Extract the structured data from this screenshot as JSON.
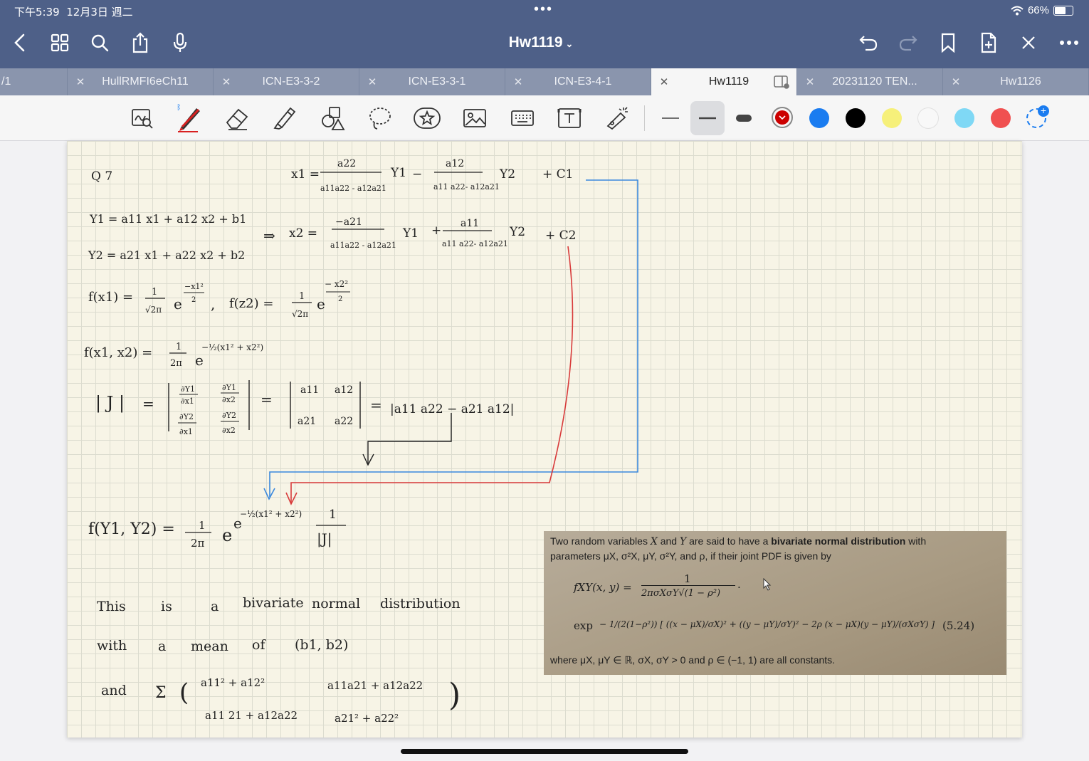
{
  "status_bar": {
    "time": "下午5:39",
    "date": "12月3日 週二",
    "dots": "•••",
    "battery": "66%"
  },
  "nav": {
    "title": "Hw1119"
  },
  "tabs": [
    {
      "label": "/1",
      "active": false
    },
    {
      "label": "HullRMFI6eCh11",
      "active": false
    },
    {
      "label": "ICN-E3-3-2",
      "active": false
    },
    {
      "label": "ICN-E3-3-1",
      "active": false
    },
    {
      "label": "ICN-E3-4-1",
      "active": false
    },
    {
      "label": "Hw1119",
      "active": true
    },
    {
      "label": "20231120 TEN...",
      "active": false
    },
    {
      "label": "Hw1126",
      "active": false
    }
  ],
  "toolbar": {
    "tools": [
      "zoom-window-icon",
      "pen-icon",
      "eraser-icon",
      "highlighter-icon",
      "shapes-icon",
      "lasso-icon",
      "sticker-icon",
      "image-icon",
      "keyboard-icon",
      "text-box-icon",
      "laser-pointer-icon"
    ],
    "stroke_widths": [
      "thin",
      "medium",
      "thick"
    ],
    "colors": [
      "#cc0000",
      "#1a7cf0",
      "#000000",
      "#f6f07a",
      "#f8f8f8",
      "#7fd8f5",
      "#f05050"
    ]
  },
  "notes": {
    "q": "Q 7",
    "x1_lhs": "x1 =",
    "x1_t1_num": "a22",
    "x1_t1_den": "a11a22 - a12a21",
    "x1_t1_var": "Y1",
    "minus": "−",
    "x1_t2_num": "a12",
    "x1_t2_den": "a11 a22- a12a21",
    "x1_t2_var": "Y2",
    "x1_c": "+ C1",
    "y1_eq": "Y1 = a11 x1 + a12 x2 + b1",
    "y2_eq": "Y2 = a21 x1 + a22 x2 + b2",
    "implies": "⇒",
    "x2_lhs": "x2 =",
    "x2_t1_num": "−a21",
    "x2_t1_den": "a11a22 - a12a21",
    "x2_t1_var": "Y1",
    "plus": "+",
    "x2_t2_num": "a11",
    "x2_t2_den": "a11 a22- a12a21",
    "x2_t2_var": "Y2",
    "x2_c": "+ C2",
    "fx1_lhs": "f(x1) =",
    "one": "1",
    "sqrt2pi": "√2π",
    "e": "e",
    "exp_x1": "−x1²",
    "two": "2",
    "comma": ",",
    "fz2_lhs": "f(z2) =",
    "exp_x2": "− x2²",
    "fx1x2_lhs": "f(x1, x2) =",
    "two_pi": "2π",
    "exp_joint": "−½(x1² + x2²)",
    "J_abs": "| J |",
    "eq": "=",
    "d_y1_x1_n": "∂Y1",
    "d_y1_x1_d": "∂x1",
    "d_y1_x2_n": "∂Y1",
    "d_y1_x2_d": "∂x2",
    "d_y2_x1_n": "∂Y2",
    "d_y2_x1_d": "∂x1",
    "d_y2_x2_n": "∂Y2",
    "d_y2_x2_d": "∂x2",
    "m_a11": "a11",
    "m_a12": "a12",
    "m_a21": "a21",
    "m_a22": "a22",
    "det_value": "|a11 a22 − a21 a12|",
    "fy_lhs": "f(Y1, Y2) =",
    "exp_final": "−½(x1² + x2²)",
    "abs_J": "|J|",
    "line1": [
      "This",
      "is",
      "a",
      "bivariate",
      "normal",
      "distribution"
    ],
    "line2": [
      "with",
      "a",
      "mean",
      "of",
      "(b1, b2)"
    ],
    "and": "and",
    "sigma": "Σ",
    "cov_11": "a11² + a12²",
    "cov_12": "a11a21 + a12a22",
    "cov_21": "a11 21 + a12a22",
    "cov_22": "a21² + a22²"
  },
  "textbook": {
    "intro_a": "Two random variables",
    "X": "X",
    "and_word": "and",
    "Y": "Y",
    "intro_b": "are said to have a",
    "bold": "bivariate normal distribution",
    "intro_c": "with",
    "params": "parameters μX, σ²X, μY, σ²Y, and ρ, if their joint PDF is given by",
    "f_lhs": "fXY(x, y) =",
    "f_num": "1",
    "f_den": "2πσXσY√(1 − ρ²)",
    "f_dot": "·",
    "exp_word": "exp",
    "exp_body": "− 1/(2(1−ρ²)) [ ((x − μX)/σX)² + ((y − μY)/σY)² − 2ρ (x − μX)(y − μY)/(σXσY) ]",
    "eq_no": "(5.24)",
    "where": "where μX, μY ∈ ℝ, σX, σY > 0 and ρ ∈ (−1, 1) are all constants."
  }
}
